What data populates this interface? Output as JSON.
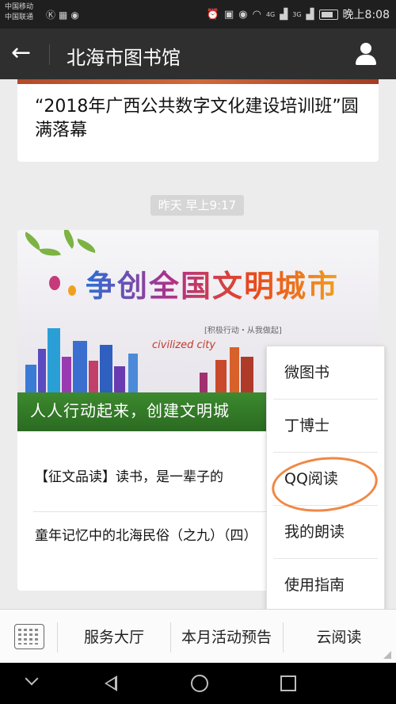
{
  "status_bar": {
    "carrier_1": "中国移动",
    "carrier_2": "中国联通",
    "network_1": "4G",
    "network_2": "3G",
    "time": "晚上8:08",
    "icons": [
      "k-icon",
      "image-icon",
      "shield-icon",
      "alarm-icon",
      "hd-icon",
      "eye-icon",
      "wifi-icon",
      "signal-icon",
      "battery-icon"
    ]
  },
  "header": {
    "title": "北海市图书馆",
    "back_icon": "arrow-left-icon",
    "profile_icon": "person-icon"
  },
  "feed": {
    "prev_article_title": "“2018年广西公共数字文化建设培训班”圆满落幕",
    "time_badge": "昨天 早上9:17",
    "banner": {
      "title": "争创全国文明城市",
      "subtitle": "[积极行动・从我做起]",
      "civ_text": "civilized city",
      "slogan": "人人行动起来，创建文明城"
    },
    "items": [
      "【征文品读】读书，是一辈子的",
      "童年记忆中的北海民俗（之九）（四）"
    ]
  },
  "popup_menu": {
    "items": [
      "微图书",
      "丁博士",
      "QQ阅读",
      "我的朗读",
      "使用指南"
    ],
    "highlighted": "QQ阅读",
    "highlight_color": "#f07a30"
  },
  "bottom_menu": {
    "keyboard_icon": "keyboard-icon",
    "items": [
      "服务大厅",
      "本月活动预告",
      "云阅读"
    ]
  },
  "system_nav": {
    "icons": [
      "chevron-down-icon",
      "back-triangle-icon",
      "home-circle-icon",
      "recent-square-icon"
    ]
  },
  "colors": {
    "navbar": "#2f2f2f",
    "statusbar": "#1f1f1f",
    "background": "#ececec",
    "accent_circle": "#f07a30"
  }
}
